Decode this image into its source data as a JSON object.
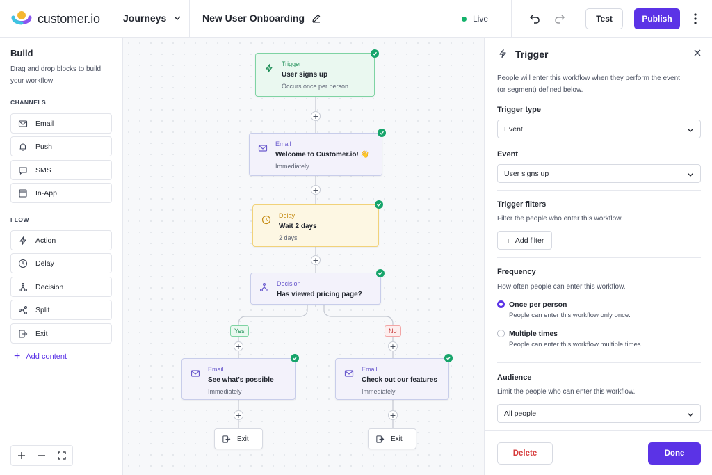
{
  "brand": {
    "name": "customer.io",
    "accent": "#5b33e6"
  },
  "topbar": {
    "section": "Journeys",
    "workflow_name": "New User Onboarding",
    "status": "Live",
    "test_label": "Test",
    "publish_label": "Publish"
  },
  "sidebar": {
    "title": "Build",
    "subtitle": "Drag and drop blocks to build your workflow",
    "channels_heading": "CHANNELS",
    "channels": [
      {
        "label": "Email",
        "icon": "mail-icon"
      },
      {
        "label": "Push",
        "icon": "bell-icon"
      },
      {
        "label": "SMS",
        "icon": "chat-icon"
      },
      {
        "label": "In-App",
        "icon": "window-icon"
      }
    ],
    "flow_heading": "FLOW",
    "flow": [
      {
        "label": "Action",
        "icon": "bolt-icon"
      },
      {
        "label": "Delay",
        "icon": "clock-icon"
      },
      {
        "label": "Decision",
        "icon": "branch-icon"
      },
      {
        "label": "Split",
        "icon": "split-icon"
      },
      {
        "label": "Exit",
        "icon": "exit-icon"
      }
    ],
    "add_content": "Add content"
  },
  "canvas": {
    "trigger": {
      "type": "Trigger",
      "title": "User signs up",
      "sub": "Occurs once per person"
    },
    "email1": {
      "type": "Email",
      "title": "Welcome to Customer.io! 👋",
      "sub": "Immediately"
    },
    "delay": {
      "type": "Delay",
      "title": "Wait 2 days",
      "sub": "2 days"
    },
    "decision": {
      "type": "Decision",
      "title": "Has viewed pricing page?"
    },
    "yes_label": "Yes",
    "no_label": "No",
    "email_yes": {
      "type": "Email",
      "title": "See what's possible",
      "sub": "Immediately"
    },
    "email_no": {
      "type": "Email",
      "title": "Check out our features",
      "sub": "Immediately"
    },
    "exit_label": "Exit"
  },
  "panel": {
    "title": "Trigger",
    "description": "People will enter this workflow when they perform the event (or segment) defined below.",
    "trigger_type_label": "Trigger type",
    "trigger_type_value": "Event",
    "event_label": "Event",
    "event_value": "User signs up",
    "filters_label": "Trigger filters",
    "filters_help": "Filter the people who enter this workflow.",
    "add_filter": "Add filter",
    "frequency_label": "Frequency",
    "frequency_help": "How often people can enter this workflow.",
    "options": [
      {
        "label": "Once per person",
        "help": "People can enter this workflow only once.",
        "selected": true
      },
      {
        "label": "Multiple times",
        "help": "People can enter this workflow multiple times.",
        "selected": false
      }
    ],
    "audience_label": "Audience",
    "audience_help": "Limit the people who can enter this workflow.",
    "audience_value": "All people",
    "delete_label": "Delete",
    "done_label": "Done"
  }
}
